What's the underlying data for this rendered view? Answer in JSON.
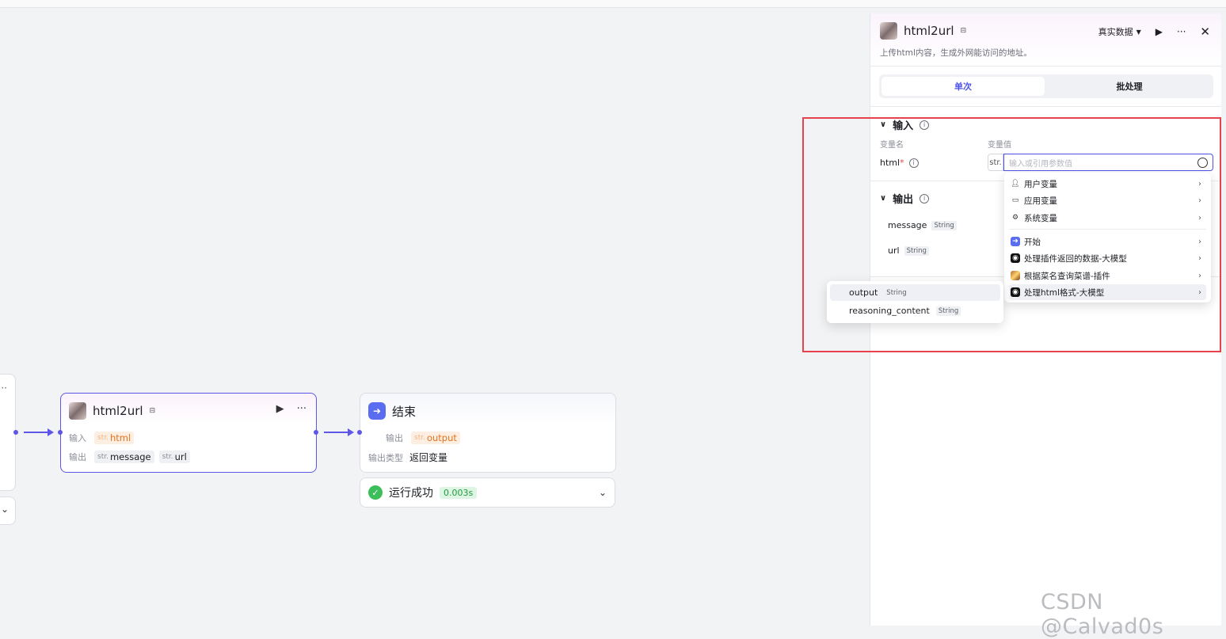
{
  "canvas": {
    "node_html": {
      "title": "html2url",
      "input_label": "输入",
      "input_param": {
        "type": "str.",
        "name": "html"
      },
      "output_label": "输出",
      "output_params": [
        {
          "type": "str.",
          "name": "message"
        },
        {
          "type": "str.",
          "name": "url"
        }
      ]
    },
    "node_end": {
      "title": "结束",
      "output_label": "输出",
      "output_param": {
        "type": "str.",
        "name": "output"
      },
      "output_type_label": "输出类型",
      "output_type_value": "返回变量"
    },
    "status": {
      "text": "运行成功",
      "time": "0.003s"
    }
  },
  "panel": {
    "title": "html2url",
    "description": "上传html内容，生成外网能访问的地址。",
    "mode": "真实数据",
    "tabs": [
      "单次",
      "批处理"
    ],
    "input": {
      "section_title": "输入",
      "col_name": "变量名",
      "col_value": "变量值",
      "var_name": "html",
      "var_required": "*",
      "type": "str.",
      "placeholder": "输入或引用参数值"
    },
    "output": {
      "section_title": "输出",
      "items": [
        {
          "name": "message",
          "type": "String"
        },
        {
          "name": "url",
          "type": "String"
        }
      ]
    }
  },
  "dropdown": {
    "items": [
      {
        "label": "用户变量",
        "icon": "user-icon"
      },
      {
        "label": "应用变量",
        "icon": "folder-icon"
      },
      {
        "label": "系统变量",
        "icon": "gear-icon"
      },
      {
        "label": "开始",
        "icon": "start-node-icon"
      },
      {
        "label": "处理插件返回的数据-大模型",
        "icon": "llm-icon"
      },
      {
        "label": "根据菜名查询菜谱-插件",
        "icon": "plugin-icon"
      },
      {
        "label": "处理html格式-大模型",
        "icon": "llm-icon"
      }
    ]
  },
  "submenu": {
    "items": [
      {
        "name": "output",
        "type": "String"
      },
      {
        "name": "reasoning_content",
        "type": "String"
      }
    ]
  },
  "watermark": "CSDN @Calvad0s",
  "colors": {
    "accent": "#4d53e8",
    "highlight_box": "#e8424f",
    "success": "#3cbf5a"
  }
}
